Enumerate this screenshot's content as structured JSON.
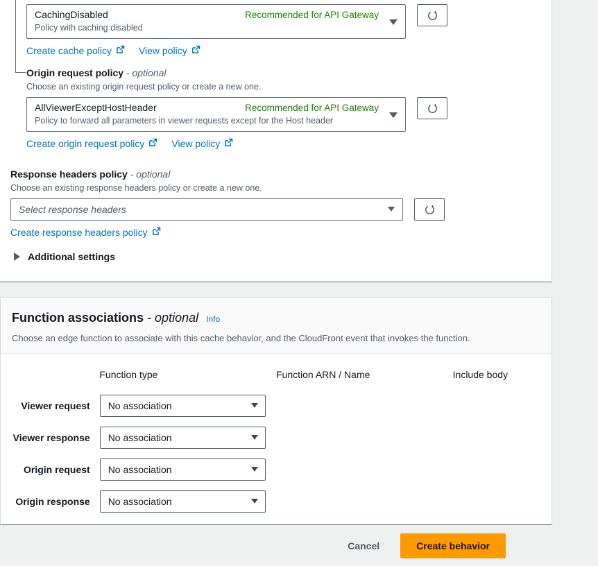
{
  "colors": {
    "link": "#0073bb",
    "recommended_tag": "#1d8102",
    "primary_button_bg": "#ff9900",
    "page_bg": "#eff0f0",
    "panel_bg": "#ffffff",
    "panel_header_bg": "#fafafa",
    "muted_text": "#545b64"
  },
  "cache_panel": {
    "cache_policy": {
      "selected_name": "CachingDisabled",
      "selected_tag": "Recommended for API Gateway",
      "selected_description": "Policy with caching disabled",
      "refresh_icon": "refresh-icon",
      "caret_icon": "chevron-down-icon",
      "links": [
        {
          "label": "Create cache policy",
          "icon": "external-link-icon"
        },
        {
          "label": "View policy",
          "icon": "external-link-icon"
        }
      ]
    },
    "origin_request_policy": {
      "label": "Origin request policy",
      "label_optional": "- optional",
      "description": "Choose an existing origin request policy or create a new one.",
      "selected_name": "AllViewerExceptHostHeader",
      "selected_tag": "Recommended for API Gateway",
      "selected_description": "Policy to forward all parameters in viewer requests except for the Host header",
      "refresh_icon": "refresh-icon",
      "caret_icon": "chevron-down-icon",
      "links": [
        {
          "label": "Create origin request policy",
          "icon": "external-link-icon"
        },
        {
          "label": "View policy",
          "icon": "external-link-icon"
        }
      ]
    },
    "response_headers_policy": {
      "label": "Response headers policy",
      "label_optional": "- optional",
      "description": "Choose an existing response headers policy or create a new one.",
      "placeholder": "Select response headers",
      "refresh_icon": "refresh-icon",
      "caret_icon": "chevron-down-icon",
      "links": [
        {
          "label": "Create response headers policy",
          "icon": "external-link-icon"
        }
      ]
    },
    "additional_settings": {
      "label": "Additional settings",
      "expanded": false,
      "icon": "triangle-right-icon"
    }
  },
  "function_associations": {
    "title": "Function associations",
    "title_optional": "- optional",
    "info_label": "Info",
    "subtitle": "Choose an edge function to associate with this cache behavior, and the CloudFront event that invokes the function.",
    "columns": [
      "",
      "Function type",
      "Function ARN / Name",
      "Include body"
    ],
    "rows": [
      {
        "event": "Viewer request",
        "function_type": "No association",
        "arn": "",
        "include_body": ""
      },
      {
        "event": "Viewer response",
        "function_type": "No association",
        "arn": "",
        "include_body": ""
      },
      {
        "event": "Origin request",
        "function_type": "No association",
        "arn": "",
        "include_body": ""
      },
      {
        "event": "Origin response",
        "function_type": "No association",
        "arn": "",
        "include_body": ""
      }
    ]
  },
  "footer": {
    "cancel_label": "Cancel",
    "submit_label": "Create behavior"
  }
}
